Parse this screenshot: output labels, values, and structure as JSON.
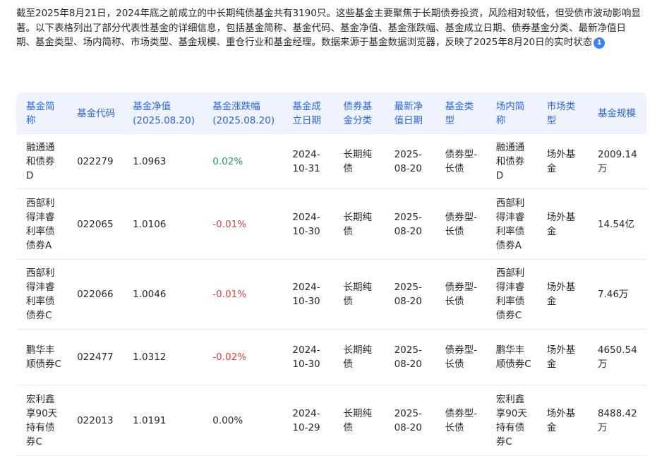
{
  "intro": {
    "text": "截至2025年8月21日，2024年底之前成立的中长期纯债基金共有3190只。这些基金主要聚焦于长期债券投资，风险相对较低，但受债市波动影响显著。以下表格列出了部分代表性基金的详细信息，包括基金简称、基金代码、基金净值、基金涨跌幅、基金成立日期、债券基金分类、最新净值日期、基金类型、场内简称、市场类型、基金规模、重仓行业和基金经理。数据来源于基金数据浏览器，反映了2025年8月20日的实时状态",
    "citation": "1"
  },
  "table": {
    "headers": [
      "基金简称",
      "基金代码",
      "基金净值(2025.08.20)",
      "基金涨跌幅(2025.08.20)",
      "基金成立日期",
      "债券基金分类",
      "最新净值日期",
      "基金类型",
      "场内简称",
      "市场类型",
      "基金规模"
    ],
    "rows": [
      {
        "name": "融通通和债券D",
        "code": "022279",
        "nav": "1.0963",
        "change": "0.02%",
        "change_dir": "up",
        "inception": "2024-10-31",
        "bond_class": "长期纯债",
        "nav_date": "2025-08-20",
        "fund_type": "债券型-长债",
        "exchange_name": "融通通和债券D",
        "market_type": "场外基金",
        "size": "2009.14万"
      },
      {
        "name": "西部利得沣睿利率债债券A",
        "code": "022065",
        "nav": "1.0106",
        "change": "-0.01%",
        "change_dir": "down",
        "inception": "2024-10-30",
        "bond_class": "长期纯债",
        "nav_date": "2025-08-20",
        "fund_type": "债券型-长债",
        "exchange_name": "西部利得沣睿利率债债券A",
        "market_type": "场外基金",
        "size": "14.54亿"
      },
      {
        "name": "西部利得沣睿利率债债券C",
        "code": "022066",
        "nav": "1.0046",
        "change": "-0.01%",
        "change_dir": "down",
        "inception": "2024-10-30",
        "bond_class": "长期纯债",
        "nav_date": "2025-08-20",
        "fund_type": "债券型-长债",
        "exchange_name": "西部利得沣睿利率债债券C",
        "market_type": "场外基金",
        "size": "7.46万"
      },
      {
        "name": "鹏华丰顺债券C",
        "code": "022477",
        "nav": "1.0312",
        "change": "-0.02%",
        "change_dir": "down",
        "inception": "2024-10-30",
        "bond_class": "长期纯债",
        "nav_date": "2025-08-20",
        "fund_type": "债券型-长债",
        "exchange_name": "鹏华丰顺债券C",
        "market_type": "场外基金",
        "size": "4650.54万"
      },
      {
        "name": "宏利鑫享90天持有债券C",
        "code": "022013",
        "nav": "1.0191",
        "change": "0.00%",
        "change_dir": "flat",
        "inception": "2024-10-29",
        "bond_class": "长期纯债",
        "nav_date": "2025-08-20",
        "fund_type": "债券型-长债",
        "exchange_name": "宏利鑫享90天持有债券C",
        "market_type": "场外基金",
        "size": "8488.42万"
      }
    ]
  },
  "colors": {
    "header_bg": "#eef3fd",
    "header_text": "#2a65e8",
    "up": "#1aa05b",
    "down": "#e0443a",
    "citation_badge": "#3b82f6"
  }
}
